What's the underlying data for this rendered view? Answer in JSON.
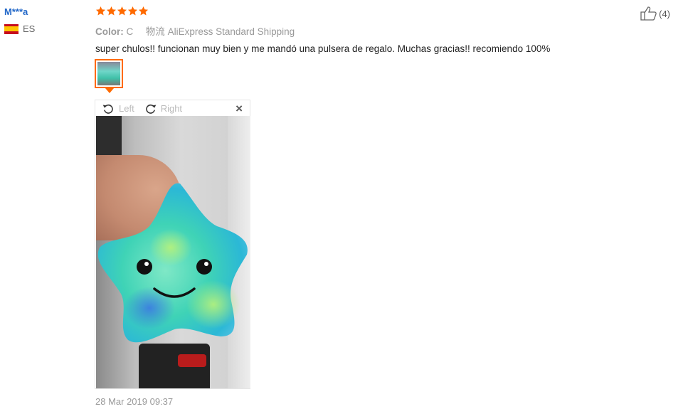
{
  "user": {
    "name": "M***a",
    "country_code": "ES",
    "flag_icon": "spain-flag-icon"
  },
  "review": {
    "rating": 5,
    "rating_max": 5,
    "color_label": "Color:",
    "color_value": "C",
    "shipping_label": "物流",
    "shipping_value": "AliExpress Standard Shipping",
    "comment": "super chulos!! funcionan muy bien y me mandó una pulsera de regalo. Muchas gracias!! recomiendo 100%",
    "timestamp": "28 Mar 2019 09:37"
  },
  "viewer": {
    "rotate_left_label": "Left",
    "rotate_right_label": "Right",
    "close_icon": "close-icon"
  },
  "helpful": {
    "count_label": "(4)",
    "icon": "thumbs-up-icon"
  },
  "colors": {
    "star": "#ff6a00",
    "accent": "#ff6a00",
    "username": "#2167c8"
  }
}
